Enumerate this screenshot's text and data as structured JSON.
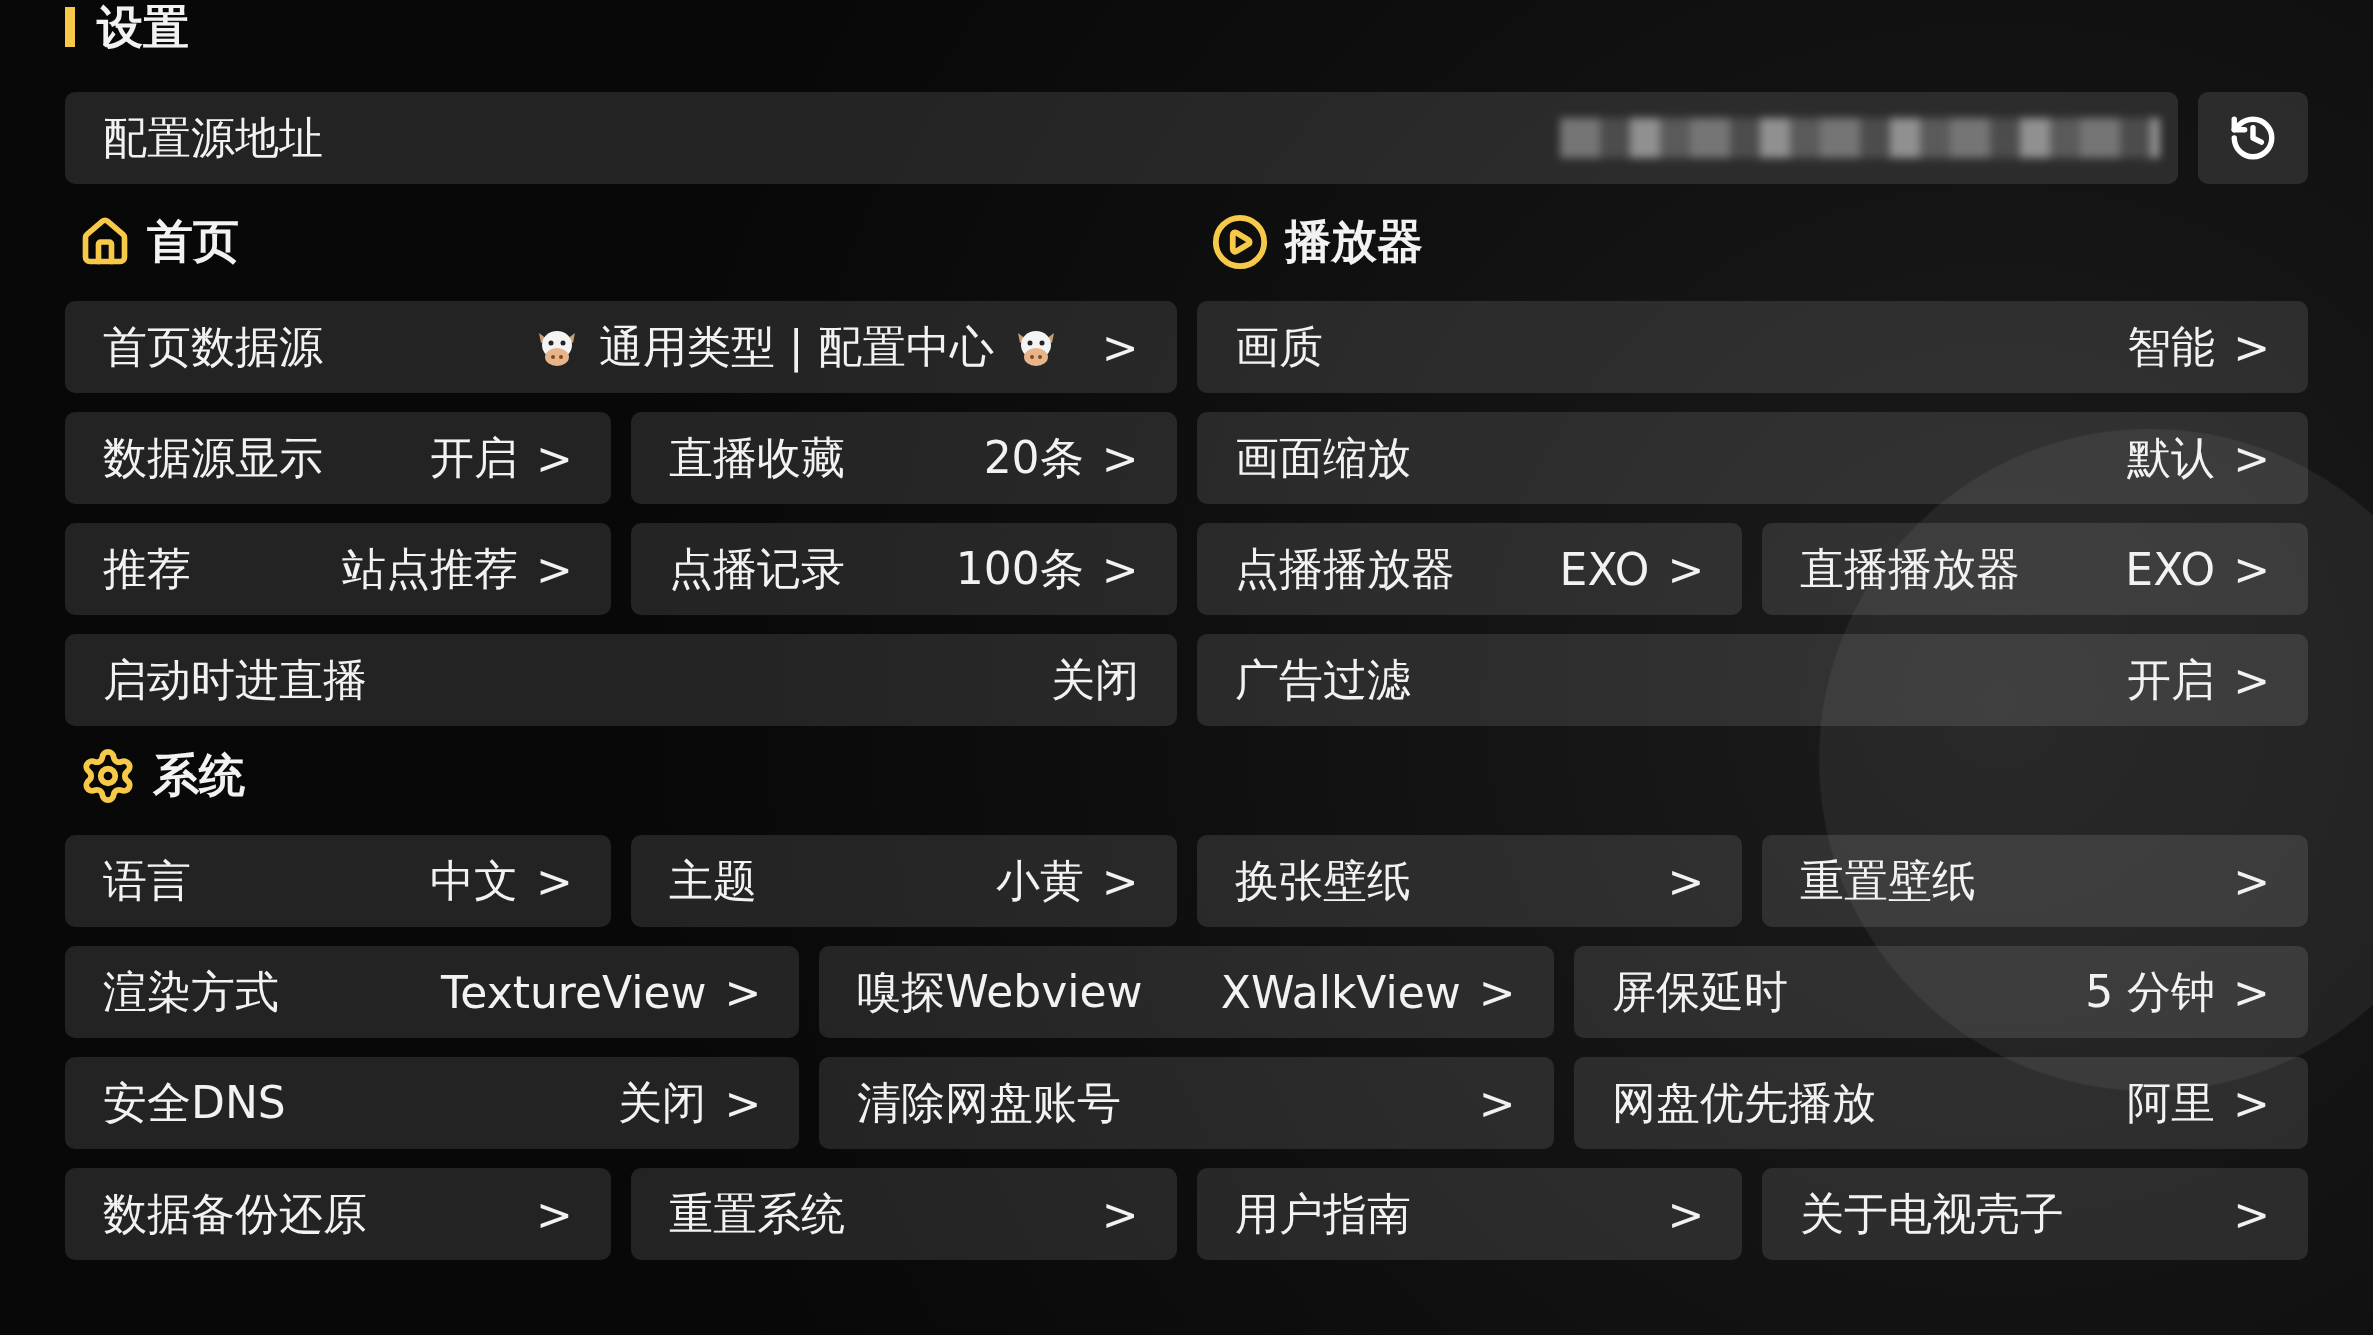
{
  "title": "设置",
  "config_source": {
    "label": "配置源地址"
  },
  "sections": [
    {
      "kind": "home",
      "title": "首页",
      "rows": [
        [
          {
            "label": "首页数据源",
            "value": "通用类型 | 配置中心",
            "cow": true,
            "arrow": ">"
          }
        ],
        [
          {
            "label": "数据源显示",
            "value": "开启",
            "arrow": ">"
          },
          {
            "label": "直播收藏",
            "value": "20条",
            "arrow": ">"
          }
        ],
        [
          {
            "label": "推荐",
            "value": "站点推荐",
            "arrow": ">"
          },
          {
            "label": "点播记录",
            "value": "100条",
            "arrow": ">"
          }
        ],
        [
          {
            "label": "启动时进直播",
            "value": "关闭"
          }
        ]
      ]
    },
    {
      "kind": "player",
      "title": "播放器",
      "rows": [
        [
          {
            "label": "画质",
            "value": "智能",
            "arrow": ">"
          }
        ],
        [
          {
            "label": "画面缩放",
            "value": "默认",
            "arrow": ">"
          }
        ],
        [
          {
            "label": "点播播放器",
            "value": "EXO",
            "arrow": ">"
          },
          {
            "label": "直播播放器",
            "value": "EXO",
            "arrow": ">"
          }
        ],
        [
          {
            "label": "广告过滤",
            "value": "开启",
            "arrow": ">"
          }
        ]
      ]
    },
    {
      "kind": "system",
      "title": "系统",
      "rows": [
        [
          {
            "label": "语言",
            "value": "中文",
            "arrow": ">"
          },
          {
            "label": "主题",
            "value": "小黄",
            "arrow": ">"
          },
          {
            "label": "换张壁纸",
            "arrow": ">"
          },
          {
            "label": "重置壁纸",
            "arrow": ">"
          }
        ],
        [
          {
            "label": "渲染方式",
            "value": "TextureView",
            "arrow": ">"
          },
          {
            "label": "嗅探Webview",
            "value": "XWalkView",
            "arrow": ">"
          },
          {
            "label": "屏保延时",
            "value": "5 分钟",
            "arrow": ">"
          }
        ],
        [
          {
            "label": "安全DNS",
            "value": "关闭",
            "arrow": ">"
          },
          {
            "label": "清除网盘账号",
            "arrow": ">"
          },
          {
            "label": "网盘优先播放",
            "value": "阿里",
            "arrow": ">"
          }
        ],
        [
          {
            "label": "数据备份还原",
            "arrow": ">"
          },
          {
            "label": "重置系统",
            "arrow": ">"
          },
          {
            "label": "用户指南",
            "arrow": ">"
          },
          {
            "label": "关于电视壳子",
            "arrow": ">"
          }
        ]
      ]
    }
  ]
}
